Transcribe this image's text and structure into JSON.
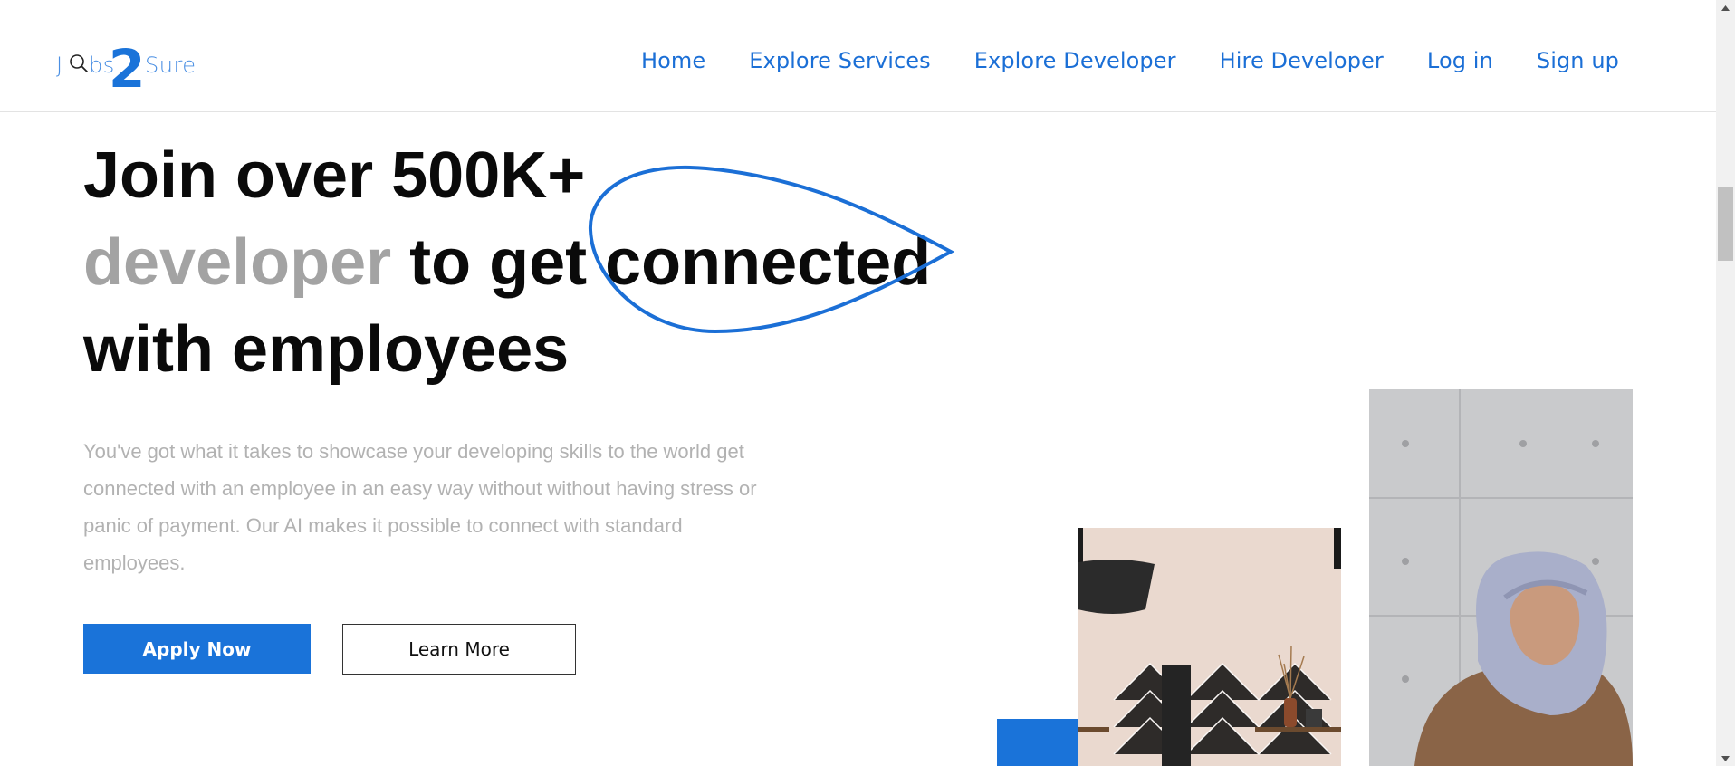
{
  "brand": {
    "logo_parts": [
      "J",
      "bs",
      "2",
      "Sure"
    ],
    "color": "#1a73d9"
  },
  "nav": {
    "items": [
      {
        "label": "Home"
      },
      {
        "label": "Explore Services"
      },
      {
        "label": "Explore Developer"
      },
      {
        "label": "Hire Developer"
      },
      {
        "label": "Log in"
      },
      {
        "label": "Sign up"
      }
    ],
    "color": "#1b6fd6"
  },
  "hero": {
    "headline_line1": "Join over 500K+",
    "headline_muted": "developer",
    "headline_line2_rest": " to get connected",
    "headline_line3": "with employees",
    "description": "You've got what it takes to showcase your developing skills to the world get connected with an employee in an easy way without without having stress or panic of payment. Our AI makes it possible to connect with standard employees.",
    "apply_label": "Apply Now",
    "learn_label": "Learn More",
    "accent": "#1a73d9",
    "muted_color": "#a3a3a3"
  },
  "images": {
    "kitchen": "kitchen-photo",
    "woman": "woman-in-hijab-photo"
  },
  "icons": {
    "search": "search-icon",
    "scroll_up": "arrow-up-icon",
    "scroll_down": "arrow-down-icon"
  }
}
